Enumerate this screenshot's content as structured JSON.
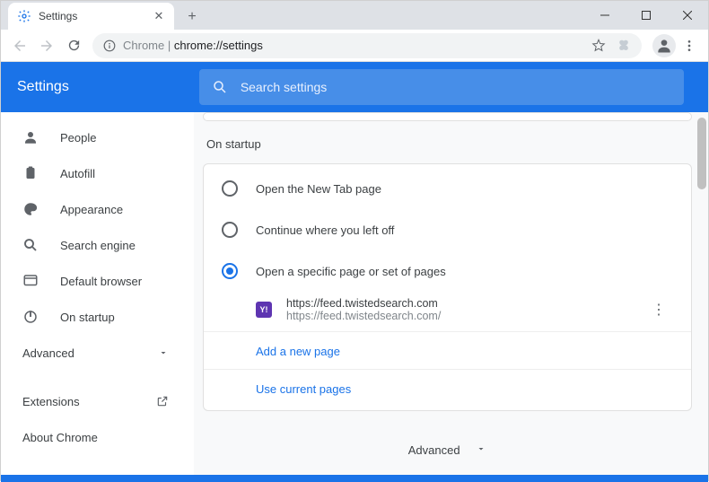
{
  "window": {
    "tab_title": "Settings",
    "omnibox_host": "Chrome",
    "omnibox_path": "chrome://settings"
  },
  "header": {
    "title": "Settings",
    "search_placeholder": "Search settings"
  },
  "sidebar": {
    "items": [
      {
        "label": "People"
      },
      {
        "label": "Autofill"
      },
      {
        "label": "Appearance"
      },
      {
        "label": "Search engine"
      },
      {
        "label": "Default browser"
      },
      {
        "label": "On startup"
      }
    ],
    "advanced": "Advanced",
    "extensions": "Extensions",
    "about": "About Chrome"
  },
  "main": {
    "section_title": "On startup",
    "radios": [
      {
        "label": "Open the New Tab page"
      },
      {
        "label": "Continue where you left off"
      },
      {
        "label": "Open a specific page or set of pages"
      }
    ],
    "page_entry": {
      "favicon_letter": "Y!",
      "url_display": "https://feed.twistedsearch.com",
      "url_full": "https://feed.twistedsearch.com/"
    },
    "add_page": "Add a new page",
    "use_current": "Use current pages",
    "advanced_bottom": "Advanced"
  }
}
